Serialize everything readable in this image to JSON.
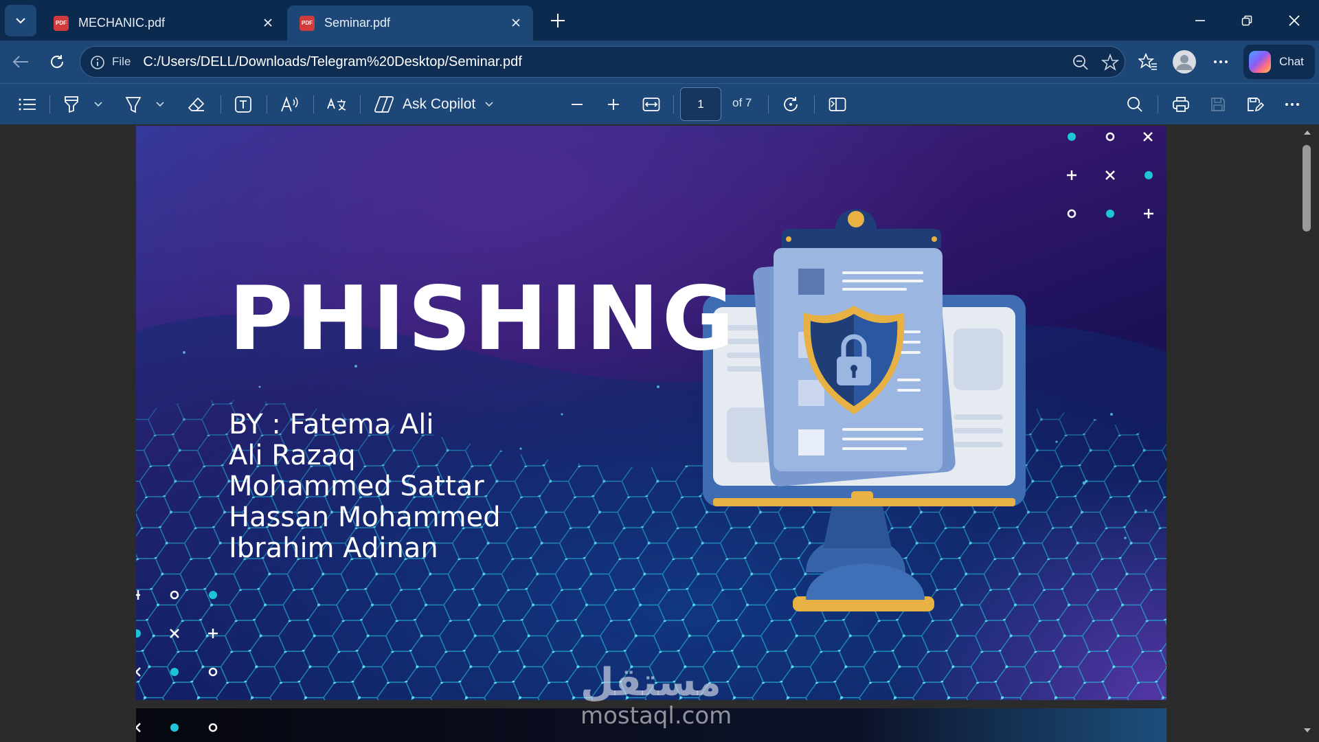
{
  "tabs": [
    {
      "label": "MECHANIC.pdf",
      "icon": "pdf-icon",
      "active": false
    },
    {
      "label": "Seminar.pdf",
      "icon": "pdf-icon",
      "active": true
    }
  ],
  "address": {
    "scheme_label": "File",
    "url": "C:/Users/DELL/Downloads/Telegram%20Desktop/Seminar.pdf"
  },
  "chat_label": "Chat",
  "pdf_toolbar": {
    "ask_copilot_label": "Ask Copilot",
    "page_number": "1",
    "page_total_label": "of 7"
  },
  "slide": {
    "title": "PHISHING",
    "authors": [
      "BY : Fatema Ali",
      "Ali Razaq",
      "Mohammed Sattar",
      "Hassan Mohammed",
      "Ibrahim Adinan"
    ]
  },
  "watermark": {
    "arabic": "مستقل",
    "latin": "mostaql.com"
  },
  "colors": {
    "titlebar": "#0c2a4e",
    "toolbar": "#1d4776",
    "viewer_bg": "#2b2b2b",
    "accent_teal": "#1ec5d4",
    "shield_gold": "#e8b143"
  }
}
